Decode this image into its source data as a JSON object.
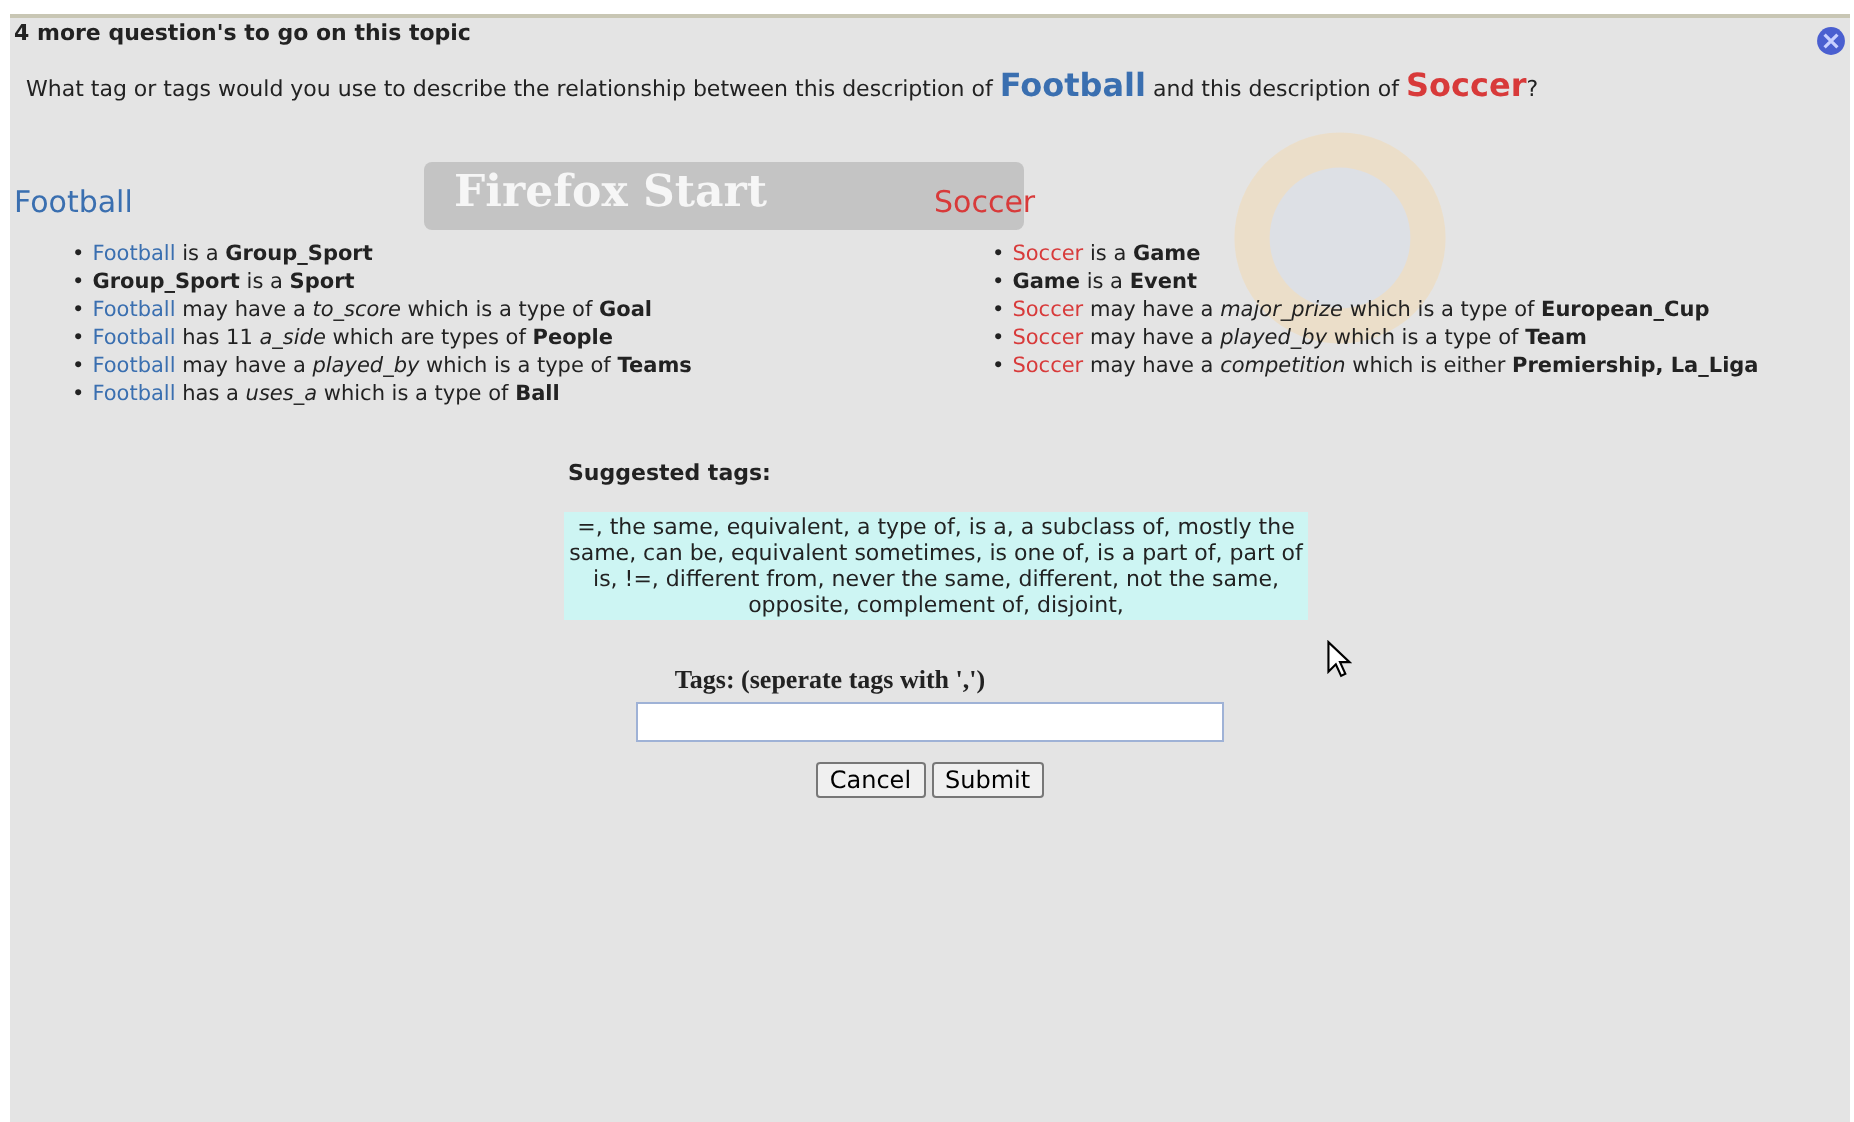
{
  "header": {
    "title": "4 more question's to go on this topic"
  },
  "question": {
    "before": "What tag or tags would you use to describe the relationship between this description of ",
    "term_a": "Football",
    "middle": " and this description of ",
    "term_b": "Soccer",
    "after": "?"
  },
  "background_page": {
    "heading": "Firefox Start"
  },
  "descriptions": [
    {
      "title": "Football",
      "color": "#3a6fb0",
      "facts": [
        {
          "marker": "•",
          "subject": "Football",
          "rest": "is a **Group_Sport**"
        },
        {
          "marker": "•",
          "rest": "**Group_Sport** is a **Sport**"
        },
        {
          "marker": "•",
          "subject": "Football",
          "rest": "may have a *to_score* which is a type of **Goal**"
        },
        {
          "marker": "•",
          "subject": "Football",
          "rest": "has 11 *a_side* which are types of **People**"
        },
        {
          "marker": "•",
          "subject": "Football",
          "rest": "may have a *played_by* which is a type of **Teams**"
        },
        {
          "marker": "•",
          "subject": "Football",
          "rest": "has a *uses_a* which is a type of **Ball**"
        }
      ]
    },
    {
      "title": "Soccer",
      "color": "#d83a3a",
      "facts": [
        {
          "marker": "•",
          "subject": "Soccer",
          "rest": "is a **Game**"
        },
        {
          "marker": "•",
          "rest": "**Game** is a **Event**"
        },
        {
          "marker": "•",
          "subject": "Soccer",
          "rest": "may have a *major_prize* which is a type of **European_Cup**"
        },
        {
          "marker": "•",
          "subject": "Soccer",
          "rest": "may have a *played_by* which is a type of **Team**"
        },
        {
          "marker": "•",
          "subject": "Soccer",
          "rest": "may have a *competition* which is either **Premiership, La_Liga**"
        }
      ]
    }
  ],
  "suggested": {
    "label": "Suggested tags:",
    "text": "=, the same, equivalent, a type of, is a, a subclass of, mostly the same, can be, equivalent sometimes, is one of, is a part of, part of is, !=, different from, never the same, different, not the same, opposite, complement of, disjoint,"
  },
  "tags_field": {
    "label": "Tags: (seperate tags with ',')"
  },
  "buttons": [
    "Cancel",
    "Submit"
  ]
}
